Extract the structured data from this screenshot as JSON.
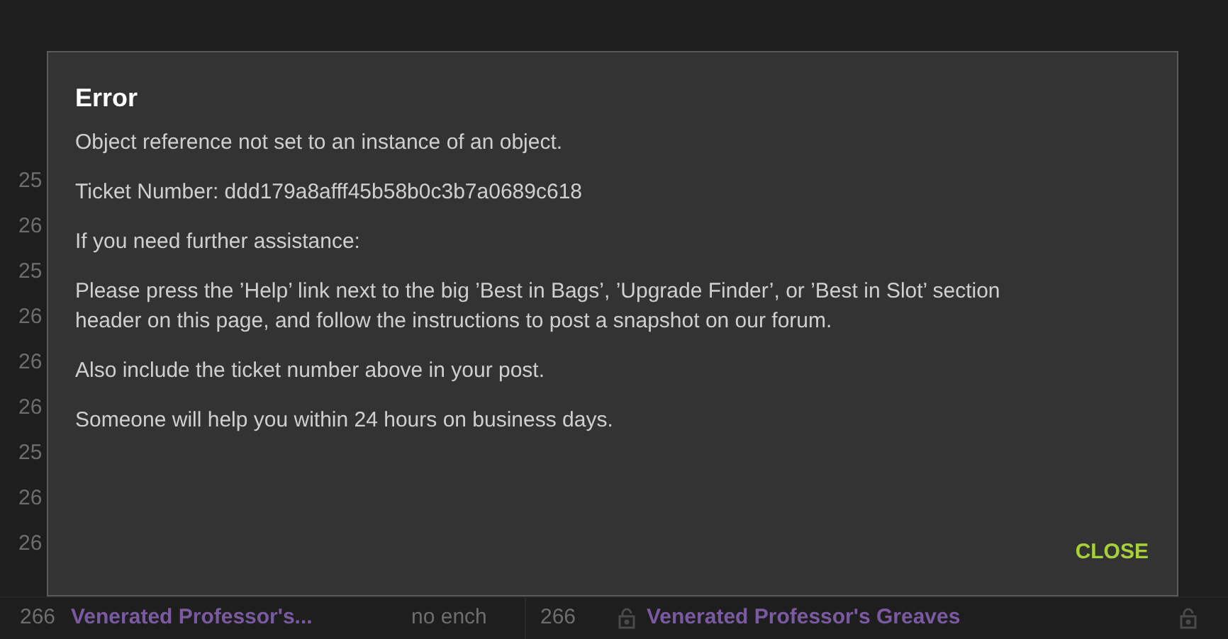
{
  "background": {
    "row_numbers": [
      "25",
      "26",
      "25",
      "26",
      "26",
      "26",
      "25",
      "26",
      "26"
    ],
    "bottom_row": {
      "level": "266",
      "item": "Venerated Professor's...",
      "enchant": "no ench",
      "level_2": "266",
      "item_2": "Venerated Professor's Greaves"
    }
  },
  "dialog": {
    "title": "Error",
    "paragraphs": [
      "Object reference not set to an instance of an object.",
      "Ticket Number: ddd179a8afff45b58b0c3b7a0689c618",
      "If you need further assistance:",
      "Please press the ’Help’ link next to the big ’Best in Bags’, ’Upgrade Finder’, or ’Best in Slot’ section header on this page, and follow the instructions to post a snapshot on our forum.",
      "Also include the ticket number above in your post.",
      "Someone will help you within 24 hours on business days."
    ],
    "button": "CLOSE"
  }
}
